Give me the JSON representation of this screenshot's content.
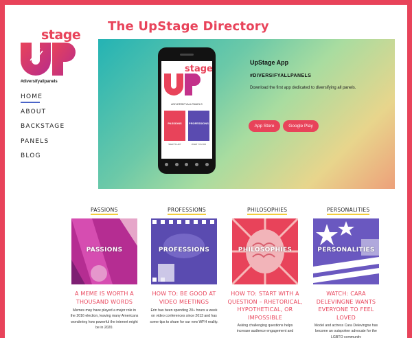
{
  "site": {
    "logo_word": "stage",
    "hashtag": "#diversifyallpanels",
    "title": "The UpStage Directory"
  },
  "nav": [
    {
      "label": "HOME",
      "active": true
    },
    {
      "label": "ABOUT",
      "active": false
    },
    {
      "label": "BACKSTAGE",
      "active": false
    },
    {
      "label": "PANELS",
      "active": false
    },
    {
      "label": "BLOG",
      "active": false
    }
  ],
  "hero": {
    "title": "UpStage App",
    "subtitle": "#DIVERSIFYALLPANELS",
    "description": "Download the first app dedicated to diversifying all panels.",
    "app_store_label": "App Store",
    "google_play_label": "Google Play",
    "phone_screen": {
      "logo_word": "stage",
      "hashtag": "#DIVERSIFYALLPANELS",
      "tile1": "PASSIONS",
      "tile2": "PROFESSIONS",
      "tile1_caption": "WHAT'S HOT",
      "tile2_caption": "WHAT YOU DO"
    }
  },
  "categories": [
    {
      "label": "PASSIONS",
      "image_word": "PASSIONS",
      "title": "A MEME IS WORTH A THOUSAND WORDS",
      "excerpt": "Memes may have played a major role in the 2016 election, leaving many Americans wondering how powerful the internet might be in 2020."
    },
    {
      "label": "PROFESSIONS",
      "image_word": "PROFESSIONS",
      "title": "HOW TO: BE GOOD AT VIDEO MEETINGS",
      "excerpt": "Erin has been spending 20+ hours a week on video conferences since 2013 and has some tips to share for our new WFH reality."
    },
    {
      "label": "PHILOSOPHIES",
      "image_word": "PHILOSOPHIES",
      "title": "HOW TO: START WITH A QUESTION – RHETORICAL, HYPOTHETICAL, OR IMPOSSIBLE",
      "excerpt": "Asking challenging questions helps increase audience engagement and"
    },
    {
      "label": "PERSONALITIES",
      "image_word": "PERSONALITIES",
      "title": "WATCH: CARA DELEVINGNE WANTS EVERYONE TO FEEL LOVED",
      "excerpt": "Model and actress Cara Delevingne has become an outspoken advocate for the LGBTQ community"
    }
  ],
  "colors": {
    "accent": "#e8435a",
    "purple": "#5a4bb0",
    "underline": "#f3cd3a",
    "nav_active": "#4a64c8"
  }
}
